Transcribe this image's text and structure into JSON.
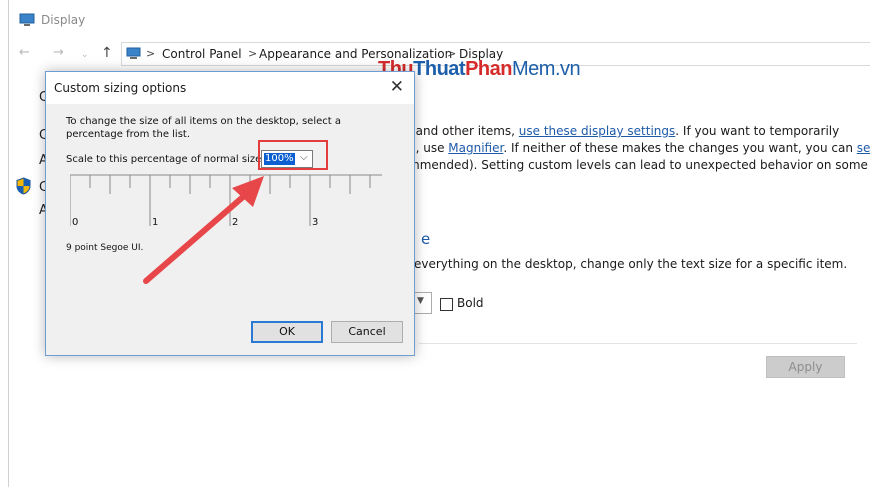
{
  "window": {
    "title": "Display",
    "nav": {
      "back": "←",
      "forward": "→",
      "recent": "⌄",
      "up": "↑"
    },
    "breadcrumb": [
      "Control Panel",
      "Appearance and Personalization",
      "Display"
    ],
    "separator": ">"
  },
  "watermark": {
    "part1": "Thu",
    "part2": "Thuat",
    "part3": "Phan",
    "part4": "Mem.vn"
  },
  "sidebar_letters": [
    "C",
    "C",
    "A",
    "C",
    "A"
  ],
  "body": {
    "line1_prefix": ", and other items, ",
    "line1_link": "use these display settings",
    "line1_suffix": ".  If you want to temporarily",
    "line2_prefix": "n, use ",
    "line2_link1": "Magnifier",
    "line2_middle": ".  If neither of these makes the changes you want, you can ",
    "line2_link2": "set a",
    "line3": "mmended).  Setting custom levels can lead to unexpected behavior on some",
    "section_tail": "e",
    "text_size_desc": "everything on the desktop, change only the text size for a specific item.",
    "bold_label": "Bold",
    "apply_label": "Apply"
  },
  "dialog": {
    "title": "Custom sizing options",
    "close": "✕",
    "instruction_line1": "To change the size of all items on the desktop, select a",
    "instruction_line2": "percentage from the list.",
    "scale_label": "Scale to this percentage of normal size:",
    "scale_value": "100%",
    "ruler_numbers": [
      "0",
      "1",
      "2",
      "3"
    ],
    "font_note": "9 point Segoe UI.",
    "ok_label": "OK",
    "cancel_label": "Cancel"
  },
  "colors": {
    "link": "#1e5aa8",
    "accent": "#0b5fd1",
    "annotation": "#e33d3d"
  }
}
